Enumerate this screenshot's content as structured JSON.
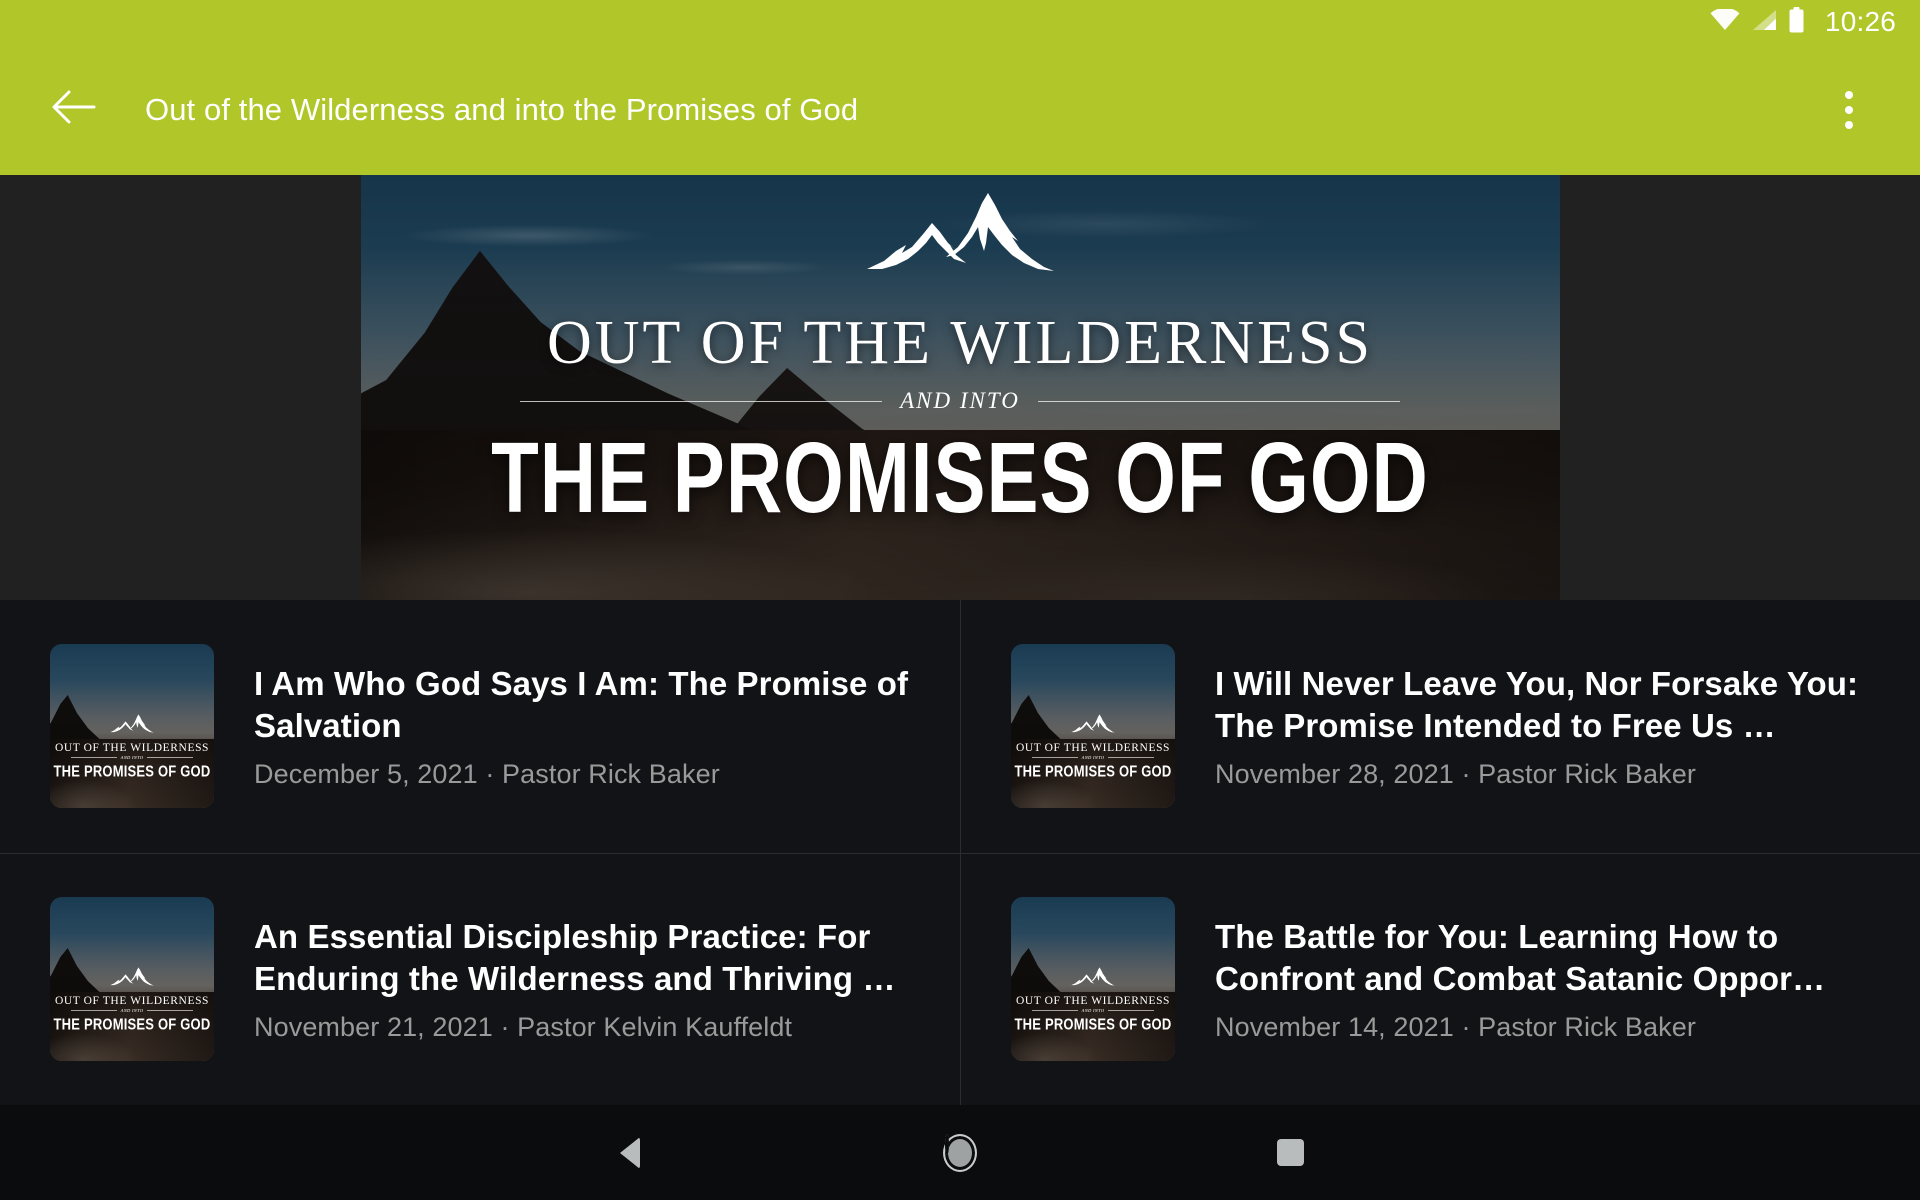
{
  "status_bar": {
    "time": "10:26",
    "icons": [
      "wifi-icon",
      "cell-signal-icon",
      "battery-icon"
    ]
  },
  "app_bar": {
    "back_icon": "arrow-back-icon",
    "title": "Out of the Wilderness and into the Promises of God",
    "overflow_icon": "more-vert-icon"
  },
  "hero": {
    "logo": "mountain-logo",
    "line1": "OUT OF THE WILDERNESS",
    "line2": "AND INTO",
    "line3": "THE PROMISES OF GOD"
  },
  "artwork": {
    "line1": "OUT OF THE WILDERNESS",
    "line2": "AND INTO",
    "line3": "THE PROMISES OF GOD"
  },
  "sermons": [
    {
      "title": "I Am Who God Says I Am: The Promise of Salvation",
      "date": "December 5, 2021",
      "speaker": "Pastor Rick Baker",
      "meta": "December 5, 2021 · Pastor Rick Baker"
    },
    {
      "title": "I Will Never Leave You, Nor Forsake You: The Promise Intended to Free Us …",
      "date": "November 28, 2021",
      "speaker": "Pastor Rick Baker",
      "meta": "November 28, 2021 · Pastor Rick Baker"
    },
    {
      "title": "An Essential Discipleship Practice: For Enduring the Wilderness and Thriving …",
      "date": "November 21, 2021",
      "speaker": "Pastor Kelvin Kauffeldt",
      "meta": "November 21, 2021 · Pastor Kelvin Kauffeldt"
    },
    {
      "title": "The Battle for You: Learning How to Confront and Combat Satanic Oppor…",
      "date": "November 14, 2021",
      "speaker": "Pastor Rick Baker",
      "meta": "November 14, 2021 · Pastor Rick Baker"
    }
  ],
  "nav_bar": {
    "back": "nav-back-icon",
    "home": "nav-home-icon",
    "recents": "nav-recents-icon"
  },
  "colors": {
    "accent_green": "#B0C629",
    "hero_bg": "#212121",
    "list_bg": "#121316",
    "divider": "#2A2C30",
    "title_text": "#FFFFFF",
    "meta_text": "#9A9A9A",
    "nav_bg": "#0B0C0E"
  }
}
